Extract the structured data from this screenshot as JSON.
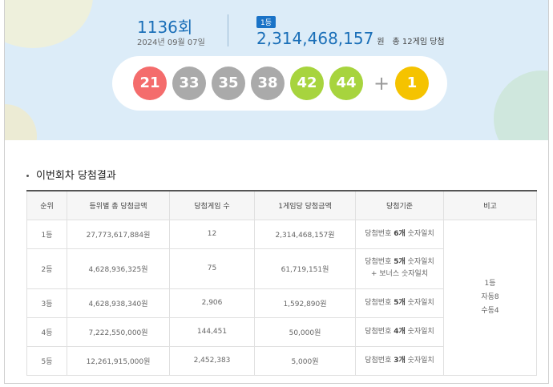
{
  "draw": {
    "number": "1136",
    "suffix": "회",
    "date": "2024년 09월 07일"
  },
  "first_prize": {
    "badge": "1등",
    "amount": "2,314,468,157",
    "unit": "원",
    "winners_text": "총 12게임 당첨"
  },
  "balls": [
    {
      "value": "21",
      "color": "#f46c6c"
    },
    {
      "value": "33",
      "color": "#aaaaaa"
    },
    {
      "value": "35",
      "color": "#aaaaaa"
    },
    {
      "value": "38",
      "color": "#aaaaaa"
    },
    {
      "value": "42",
      "color": "#a7d43e"
    },
    {
      "value": "44",
      "color": "#a7d43e"
    }
  ],
  "plus_sign": "+",
  "bonus_ball": {
    "value": "1",
    "color": "#f5c300"
  },
  "section": {
    "title": "이번회차 당첨결과"
  },
  "table": {
    "headers": [
      "순위",
      "등위별 총 당첨금액",
      "당첨게임 수",
      "1게임당 당첨금액",
      "당첨기준",
      "비고"
    ],
    "rows": [
      {
        "rank": "1등",
        "total": "27,773,617,884원",
        "games": "12",
        "per_game": "2,314,468,157원",
        "basis_pre": "당첨번호 ",
        "basis_strong": "6개",
        "basis_post": " 숫자일치",
        "basis_line2": ""
      },
      {
        "rank": "2등",
        "total": "4,628,936,325원",
        "games": "75",
        "per_game": "61,719,151원",
        "basis_pre": "당첨번호 ",
        "basis_strong": "5개",
        "basis_post": " 숫자일치",
        "basis_line2": "+ 보너스 숫자일치"
      },
      {
        "rank": "3등",
        "total": "4,628,938,340원",
        "games": "2,906",
        "per_game": "1,592,890원",
        "basis_pre": "당첨번호 ",
        "basis_strong": "5개",
        "basis_post": " 숫자일치",
        "basis_line2": ""
      },
      {
        "rank": "4등",
        "total": "7,222,550,000원",
        "games": "144,451",
        "per_game": "50,000원",
        "basis_pre": "당첨번호 ",
        "basis_strong": "4개",
        "basis_post": " 숫자일치",
        "basis_line2": ""
      },
      {
        "rank": "5등",
        "total": "12,261,915,000원",
        "games": "2,452,383",
        "per_game": "5,000원",
        "basis_pre": "당첨번호 ",
        "basis_strong": "3개",
        "basis_post": " 숫자일치",
        "basis_line2": ""
      }
    ],
    "note": {
      "line1": "1등",
      "line2": "자동8",
      "line3": "수동4"
    }
  }
}
